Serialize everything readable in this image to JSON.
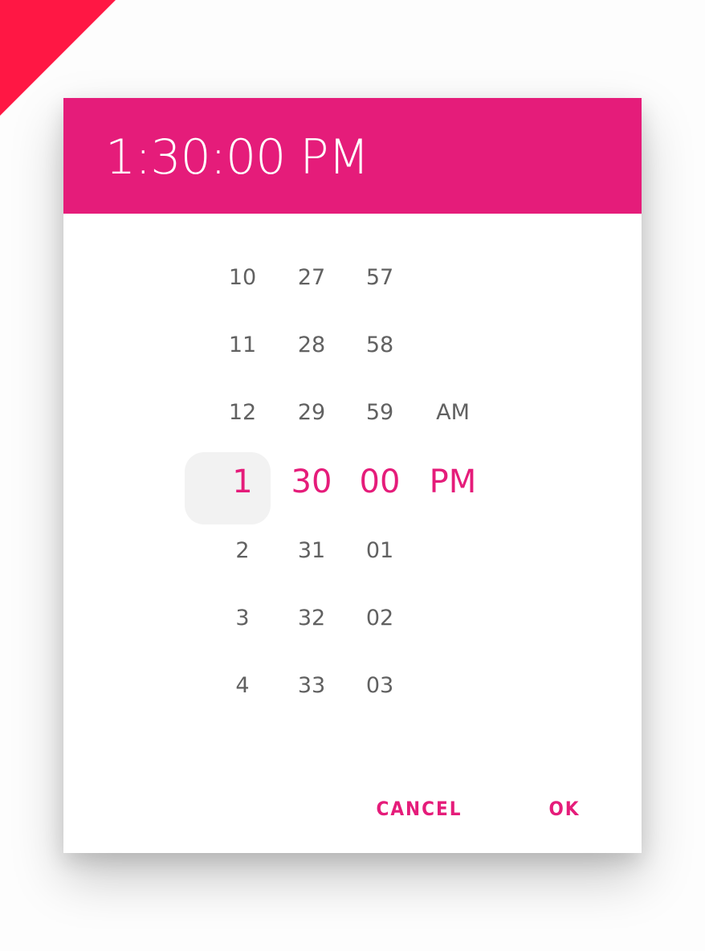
{
  "colors": {
    "accent": "#e51c7a",
    "corner": "#ff1744",
    "text_muted": "#616161"
  },
  "header": {
    "time": "1:30:00 PM"
  },
  "picker": {
    "hours": [
      "10",
      "11",
      "12",
      "1",
      "2",
      "3",
      "4"
    ],
    "minutes": [
      "27",
      "28",
      "29",
      "30",
      "31",
      "32",
      "33"
    ],
    "seconds": [
      "57",
      "58",
      "59",
      "00",
      "01",
      "02",
      "03"
    ],
    "period": [
      "AM",
      "PM"
    ],
    "selected": {
      "hour": "1",
      "minute": "30",
      "second": "00",
      "period": "PM"
    }
  },
  "actions": {
    "cancel_label": "CANCEL",
    "ok_label": "OK"
  }
}
